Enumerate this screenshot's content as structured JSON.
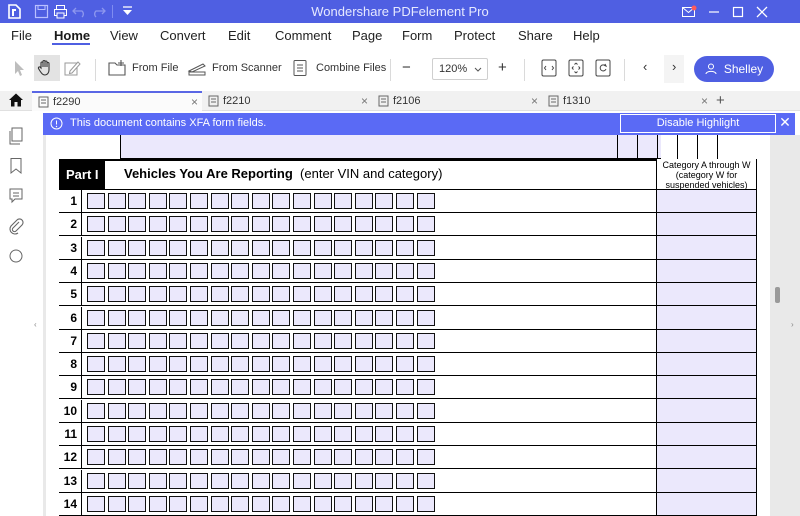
{
  "app": {
    "title": "Wondershare PDFelement Pro",
    "brand_color": "#4f5fe2"
  },
  "menu": [
    "File",
    "Home",
    "View",
    "Convert",
    "Edit",
    "Comment",
    "Page",
    "Form",
    "Protect",
    "Share",
    "Help"
  ],
  "menu_active": "Home",
  "toolbar": {
    "from_file": "From File",
    "from_scanner": "From Scanner",
    "combine_files": "Combine Files",
    "zoom_minus": "−",
    "zoom_value": "120%",
    "zoom_plus": "+",
    "user_name": "Shelley"
  },
  "tabs": [
    {
      "name": "f2290",
      "active": true
    },
    {
      "name": "f2210",
      "active": false
    },
    {
      "name": "f2106",
      "active": false
    },
    {
      "name": "f1310",
      "active": false
    }
  ],
  "new_tab": "+",
  "banner": {
    "message": "This document contains XFA form fields.",
    "button": "Disable Highlight",
    "close": "✕"
  },
  "form": {
    "part_label": "Part I",
    "part_title": "Vehicles You Are Reporting",
    "part_subtitle": "(enter VIN and category)",
    "category_header": "Category A through W (category W for suspended vehicles)",
    "rows": [
      "1",
      "2",
      "3",
      "4",
      "5",
      "6",
      "7",
      "8",
      "9",
      "10",
      "11",
      "12",
      "13",
      "14"
    ],
    "vin_box_count": 17
  }
}
